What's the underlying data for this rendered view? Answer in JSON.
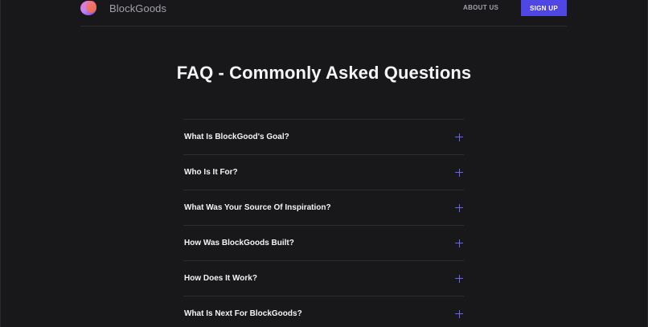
{
  "header": {
    "brand": "BlockGoods",
    "nav_link": "ABOUT US",
    "signup_label": "SIGN UP"
  },
  "main": {
    "title": "FAQ - Commonly Asked Questions",
    "faq": [
      {
        "question": "What Is BlockGood's Goal?"
      },
      {
        "question": "Who Is It For?"
      },
      {
        "question": "What Was Your Source Of Inspiration?"
      },
      {
        "question": "How Was BlockGoods Built?"
      },
      {
        "question": "How Does It Work?"
      },
      {
        "question": "What Is Next For BlockGoods?"
      }
    ]
  },
  "colors": {
    "background": "#18181b",
    "accent": "#4f46e5",
    "plus_icon": "#6366f1"
  },
  "icons": {
    "logo": "gradient-blob-logo-icon",
    "expand": "plus-icon"
  }
}
